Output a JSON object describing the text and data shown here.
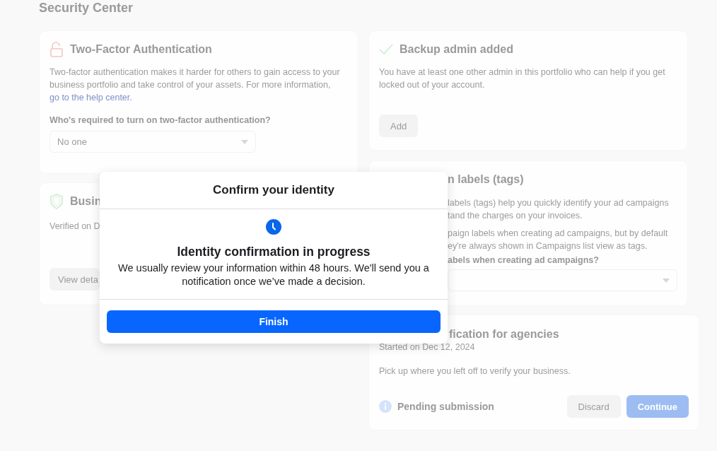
{
  "page_title": "Security Center",
  "two_factor": {
    "title": "Two-Factor Authentication",
    "description": "Two-factor authentication makes it harder for others to gain access to your business portfolio and take control of your assets. For more information,",
    "link": "go to the help center.",
    "question": "Who's required to turn on two-factor authentication?",
    "dropdown": {
      "value": "No one"
    }
  },
  "business_verification": {
    "title": "Busin",
    "status": "Verified on D",
    "button": "View deta"
  },
  "backup_admin": {
    "title": "Backup admin added",
    "description": "You have at least one other admin in this portfolio who can help if you get locked out of your account.",
    "button": "Add"
  },
  "campaign_labels": {
    "title": "n labels (tags)",
    "lines": [
      "labels (tags) help you quickly identify your ad campaigns",
      "tand the charges on your invoices.",
      "paign labels when creating ad campaigns, but by default",
      "ey're always shown in Campaigns list view as tags."
    ],
    "question": "abels when creating ad campaigns?"
  },
  "verification": {
    "title": "fication for agencies",
    "started": "Started on Dec 12, 2024",
    "description": "Pick up where you left off to verify your business.",
    "status": "Pending submission",
    "buttons": [
      {
        "label": "Discard",
        "kind": "secondary"
      },
      {
        "label": "Continue",
        "kind": "primary"
      }
    ]
  },
  "dialog": {
    "title": "Confirm your identity",
    "heading": "Identity confirmation in progress",
    "message": "We usually review your information within 48 hours. We'll send you a notification once we’ve made a decision.",
    "button": "Finish"
  }
}
